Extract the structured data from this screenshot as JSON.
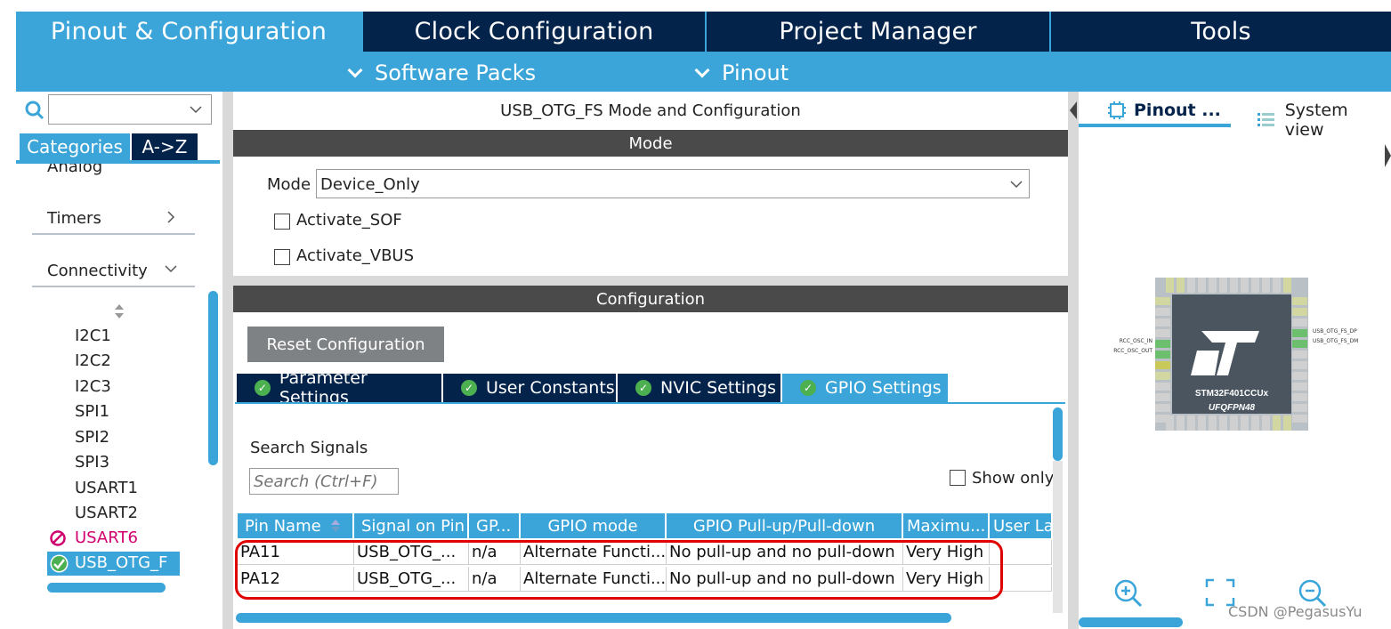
{
  "nav": {
    "tabs": [
      "Pinout & Configuration",
      "Clock Configuration",
      "Project Manager",
      "Tools"
    ],
    "subtabs": [
      "Software Packs",
      "Pinout"
    ]
  },
  "left": {
    "search_value": "",
    "cat_buttons": [
      "Categories",
      "A->Z"
    ],
    "categories": [
      "Analog",
      "Timers",
      "Connectivity"
    ],
    "items": [
      "I2C1",
      "I2C2",
      "I2C3",
      "SPI1",
      "SPI2",
      "SPI3",
      "USART1",
      "USART2",
      "USART6",
      "USB_OTG_F"
    ]
  },
  "mid": {
    "title": "USB_OTG_FS Mode and Configuration",
    "mode_header": "Mode",
    "mode_label": "Mode",
    "mode_value": "Device_Only",
    "activate_sof": "Activate_SOF",
    "activate_vbus": "Activate_VBUS",
    "config_header": "Configuration",
    "reset_button": "Reset Configuration",
    "tabs": [
      "Parameter Settings",
      "User Constants",
      "NVIC Settings",
      "GPIO Settings"
    ],
    "search_signals_label": "Search Signals",
    "search_placeholder": "Search (Ctrl+F)",
    "show_only": "Show only",
    "columns": [
      "Pin Name",
      "Signal on Pin",
      "GP...",
      "GPIO mode",
      "GPIO Pull-up/Pull-down",
      "Maximu...",
      "User La"
    ],
    "rows": [
      [
        "PA11",
        "USB_OTG_...",
        "n/a",
        "Alternate Functi...",
        "No pull-up and no pull-down",
        "Very High",
        ""
      ],
      [
        "PA12",
        "USB_OTG_...",
        "n/a",
        "Alternate Functi...",
        "No pull-up and no pull-down",
        "Very High",
        ""
      ]
    ]
  },
  "right": {
    "tabs": [
      "Pinout ...",
      "System view"
    ],
    "chip_name": "STM32F401CCUx",
    "chip_package": "UFQFPN48",
    "pin_labels_left": [
      "RCC_OSC_IN",
      "RCC_OSC_OUT"
    ],
    "pin_labels_right": [
      "USB_OTG_FS_DP",
      "USB_OTG_FS_DM"
    ]
  },
  "watermark": "CSDN @PegasusYu",
  "colors": {
    "accent": "#3ba5d9",
    "navy": "#03234b",
    "header": "#4a4a4a",
    "highlight": "#e00000",
    "ok": "#4caf50",
    "error": "#d0006f"
  }
}
